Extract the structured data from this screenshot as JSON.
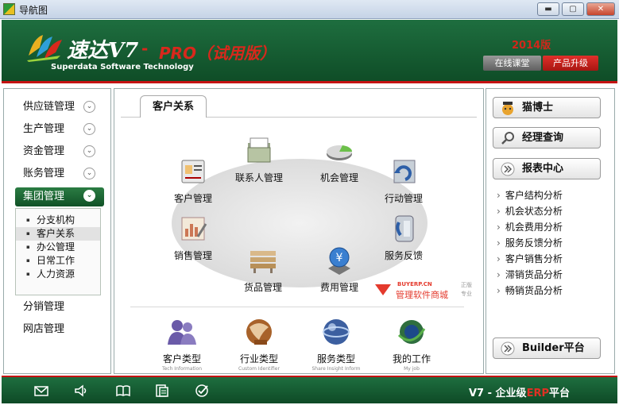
{
  "window": {
    "title": "导航图",
    "min": "▬",
    "max": "▢",
    "close": "✕"
  },
  "header": {
    "brand": "速达V7",
    "dash": "-",
    "pro": "PRO（试用版）",
    "subtitle": "Superdata Software Technology",
    "year": "2014版",
    "online_class": "在线课堂",
    "upgrade": "产品升级"
  },
  "sidebar": {
    "items_top": [
      {
        "label": "供应链管理",
        "icon": "chevron-down-icon"
      },
      {
        "label": "生产管理",
        "icon": "chevron-down-icon"
      },
      {
        "label": "资金管理",
        "icon": "chevron-down-icon"
      },
      {
        "label": "账务管理",
        "icon": "chevron-down-icon"
      },
      {
        "label": "集团管理",
        "icon": "chevron-down-icon",
        "active": true
      }
    ],
    "submenu": [
      "分支机构",
      "客户关系",
      "办公管理",
      "日常工作",
      "人力资源"
    ],
    "submenu_selected": "客户关系",
    "items_bottom": [
      "分销管理",
      "网店管理"
    ]
  },
  "main": {
    "tab": "客户关系",
    "modules": [
      {
        "label": "客户管理",
        "icon": "customer-card-icon"
      },
      {
        "label": "联系人管理",
        "icon": "contact-folder-icon"
      },
      {
        "label": "机会管理",
        "icon": "opportunity-pie-icon"
      },
      {
        "label": "行动管理",
        "icon": "action-arrow-icon"
      },
      {
        "label": "销售管理",
        "icon": "sales-chart-icon"
      },
      {
        "label": "服务反馈",
        "icon": "service-phone-icon"
      },
      {
        "label": "货品管理",
        "icon": "goods-stack-icon"
      },
      {
        "label": "费用管理",
        "icon": "yen-coin-icon"
      }
    ],
    "bottom_modules": [
      {
        "label": "客户类型",
        "en": "Tech Information",
        "icon": "people-icon"
      },
      {
        "label": "行业类型",
        "en": "Custom Identifier",
        "icon": "industry-globe-icon"
      },
      {
        "label": "服务类型",
        "en": "Share Insight Inform",
        "icon": "service-sphere-icon"
      },
      {
        "label": "我的工作",
        "en": "My job",
        "icon": "my-work-globe-icon"
      }
    ],
    "watermark": {
      "site": "BUYERP.CN",
      "name": "管理软件商城",
      "tag1": "正版",
      "tag2": "专业"
    }
  },
  "right": {
    "doctor": "猫博士",
    "manager_query": "经理查询",
    "report_center": "报表中心",
    "reports": [
      "客户结构分析",
      "机会状态分析",
      "机会费用分析",
      "服务反馈分析",
      "客户销售分析",
      "滞销货品分析",
      "畅销货品分析"
    ],
    "builder": "Builder平台"
  },
  "footer": {
    "icons": [
      "mail-icon",
      "speaker-icon",
      "book-icon",
      "document-icon",
      "check-circle-icon"
    ],
    "text_prefix": "V7 - 企业级",
    "text_erp": "ERP",
    "text_suffix": "平台"
  }
}
